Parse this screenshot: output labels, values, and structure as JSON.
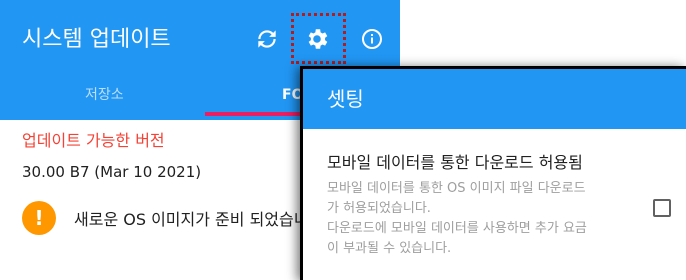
{
  "appbar": {
    "title": "시스템 업데이트",
    "icons": [
      "refresh-icon",
      "gear-icon",
      "info-icon"
    ]
  },
  "tabs": [
    {
      "label": "저장소"
    },
    {
      "label": "FOT"
    }
  ],
  "content": {
    "section_title": "업데이트 가능한 버전",
    "version": "30.00 B7 (Mar 10 2021)",
    "notice_icon": "!",
    "notice_text": "새로운 OS 이미지가 준비 되었습니"
  },
  "dialog": {
    "title": "셋팅",
    "preference": {
      "title": "모바일 데이터를 통한 다운로드 허용됨",
      "summary_lines": [
        "모바일 데이터를 통한 OS 이미지 파일 다운로드",
        "가 허용되었습니다.",
        "다운로드에 모바일 데이터를 사용하면 추가 요금",
        "이 부과될 수 있습니다."
      ],
      "checked": false
    }
  },
  "colors": {
    "primary": "#2196f3",
    "accent": "#e91e63",
    "section_title": "#f44336",
    "warning": "#ff9800",
    "highlight": "#b71c1c"
  }
}
